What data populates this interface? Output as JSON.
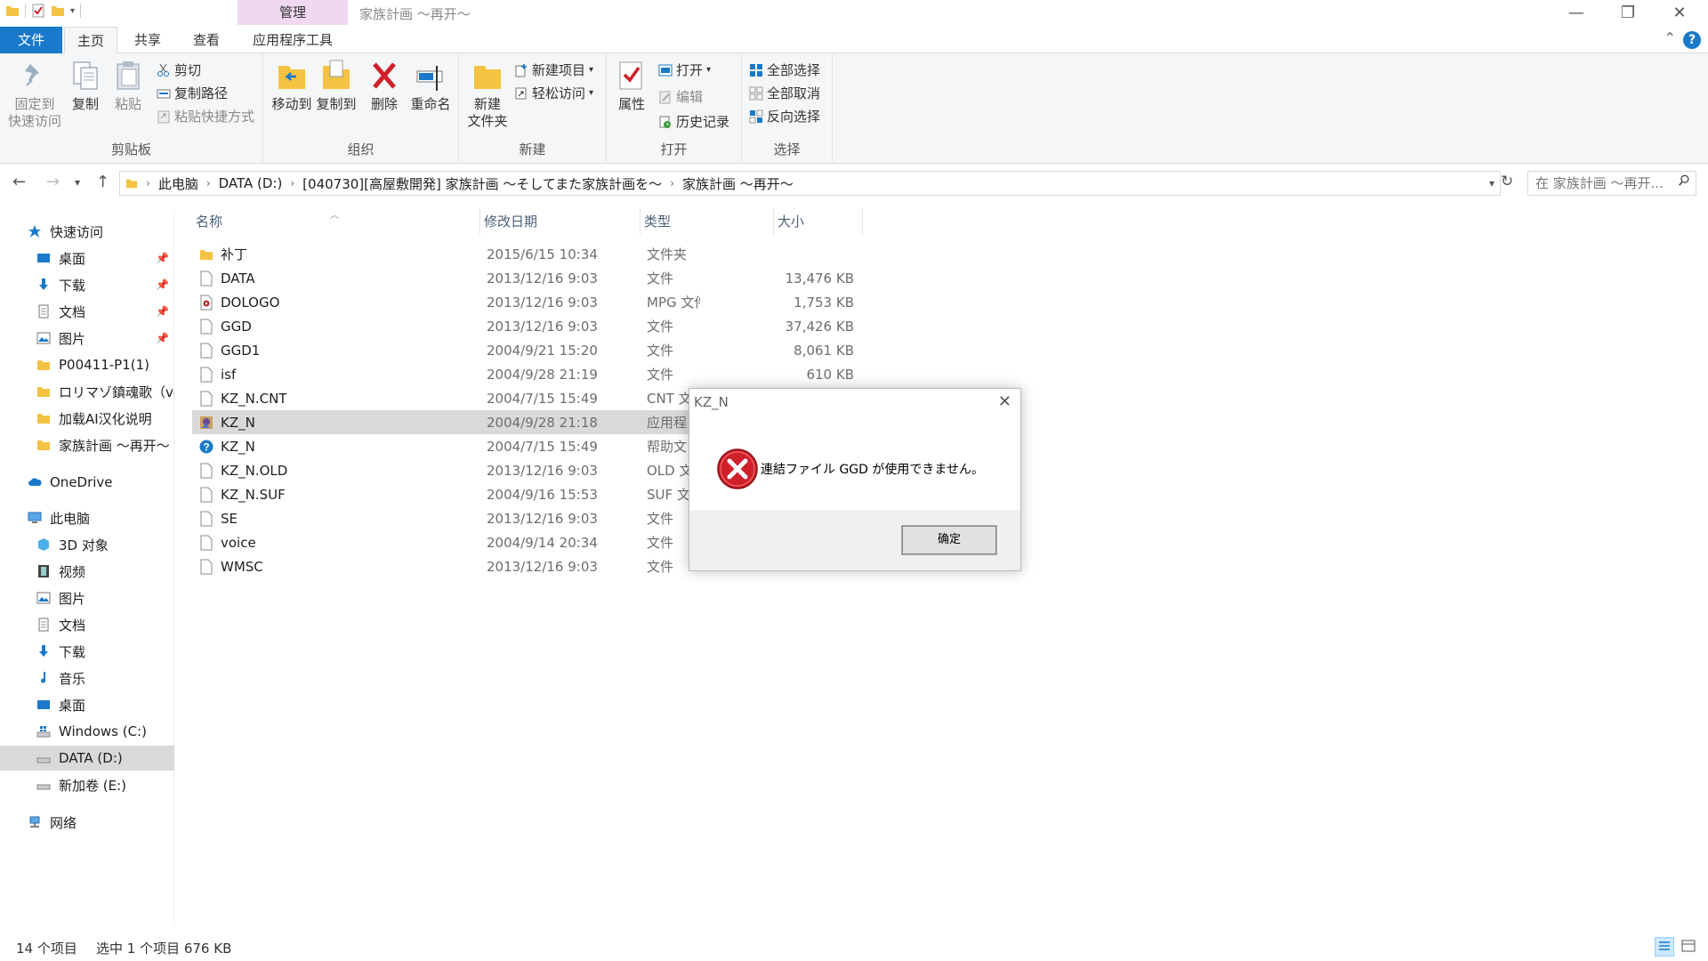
{
  "window": {
    "title": "家族計画 ～再开～",
    "context_tab": "管理"
  },
  "tabs": {
    "file": "文件",
    "home": "主页",
    "share": "共享",
    "view": "查看",
    "app_tools": "应用程序工具"
  },
  "ribbon": {
    "clipboard": {
      "label": "剪贴板",
      "pin": "固定到\n快速访问",
      "copy": "复制",
      "paste": "粘贴",
      "cut": "剪切",
      "copy_path": "复制路径",
      "paste_shortcut": "粘贴快捷方式"
    },
    "organize": {
      "label": "组织",
      "move_to": "移动到",
      "copy_to": "复制到",
      "delete": "删除",
      "rename": "重命名"
    },
    "new": {
      "label": "新建",
      "new_folder": "新建\n文件夹",
      "new_item": "新建项目",
      "easy_access": "轻松访问"
    },
    "open": {
      "label": "打开",
      "properties": "属性",
      "open": "打开",
      "edit": "编辑",
      "history": "历史记录"
    },
    "select": {
      "label": "选择",
      "select_all": "全部选择",
      "select_none": "全部取消",
      "invert": "反向选择"
    }
  },
  "address": {
    "segments": [
      "此电脑",
      "DATA (D:)",
      "[040730][高屋敷開発] 家族計画 ～そしてまた家族計画を～",
      "家族計画 ～再开～"
    ],
    "search_placeholder": "在 家族計画 ～再开..."
  },
  "nav": {
    "quick_access": "快速访问",
    "desktop": "桌面",
    "downloads": "下载",
    "documents": "文档",
    "pictures": "图片",
    "f1": "P00411-P1(1)",
    "f2": "ロリマゾ鎮魂歌（ve",
    "f3": "加载AI汉化说明",
    "f4": "家族計画 ～再开～",
    "onedrive": "OneDrive",
    "this_pc": "此电脑",
    "objects3d": "3D 对象",
    "videos": "视频",
    "pictures2": "图片",
    "documents2": "文档",
    "downloads2": "下载",
    "music": "音乐",
    "desktop2": "桌面",
    "drive_c": "Windows (C:)",
    "drive_d": "DATA (D:)",
    "drive_e": "新加卷 (E:)",
    "network": "网络"
  },
  "columns": {
    "name": "名称",
    "date": "修改日期",
    "type": "类型",
    "size": "大小"
  },
  "files": [
    {
      "name": "补丁",
      "date": "2015/6/15 10:34",
      "type": "文件夹",
      "size": "",
      "icon": "folder-icon"
    },
    {
      "name": "DATA",
      "date": "2013/12/16 9:03",
      "type": "文件",
      "size": "13,476 KB",
      "icon": "file-icon"
    },
    {
      "name": "DOLOGO",
      "date": "2013/12/16 9:03",
      "type": "MPG 文件",
      "size": "1,753 KB",
      "icon": "media-file-icon"
    },
    {
      "name": "GGD",
      "date": "2013/12/16 9:03",
      "type": "文件",
      "size": "37,426 KB",
      "icon": "file-icon"
    },
    {
      "name": "GGD1",
      "date": "2004/9/21 15:20",
      "type": "文件",
      "size": "8,061 KB",
      "icon": "file-icon"
    },
    {
      "name": "isf",
      "date": "2004/9/28 21:19",
      "type": "文件",
      "size": "610 KB",
      "icon": "file-icon"
    },
    {
      "name": "KZ_N.CNT",
      "date": "2004/7/15 15:49",
      "type": "CNT 文",
      "size": "",
      "icon": "file-icon"
    },
    {
      "name": "KZ_N",
      "date": "2004/9/28 21:18",
      "type": "应用程",
      "size": "",
      "icon": "app-icon"
    },
    {
      "name": "KZ_N",
      "date": "2004/7/15 15:49",
      "type": "帮助文",
      "size": "",
      "icon": "help-file-icon"
    },
    {
      "name": "KZ_N.OLD",
      "date": "2013/12/16 9:03",
      "type": "OLD 文",
      "size": "",
      "icon": "file-icon"
    },
    {
      "name": "KZ_N.SUF",
      "date": "2004/9/16 15:53",
      "type": "SUF 文",
      "size": "",
      "icon": "file-icon"
    },
    {
      "name": "SE",
      "date": "2013/12/16 9:03",
      "type": "文件",
      "size": "",
      "icon": "file-icon"
    },
    {
      "name": "voice",
      "date": "2004/9/14 20:34",
      "type": "文件",
      "size": "",
      "icon": "file-icon"
    },
    {
      "name": "WMSC",
      "date": "2013/12/16 9:03",
      "type": "文件",
      "size": "",
      "icon": "file-icon"
    }
  ],
  "dialog": {
    "title": "KZ_N",
    "message": "連結ファイル GGD が使用できません。",
    "ok": "确定"
  },
  "status": {
    "count": "14 个项目",
    "selected": "选中 1 个项目  676 KB"
  },
  "colors": {
    "accent": "#1979ca",
    "selection": "#d9d9d9",
    "context_tab": "#f0d8f0",
    "error_red": "#d0202a"
  }
}
